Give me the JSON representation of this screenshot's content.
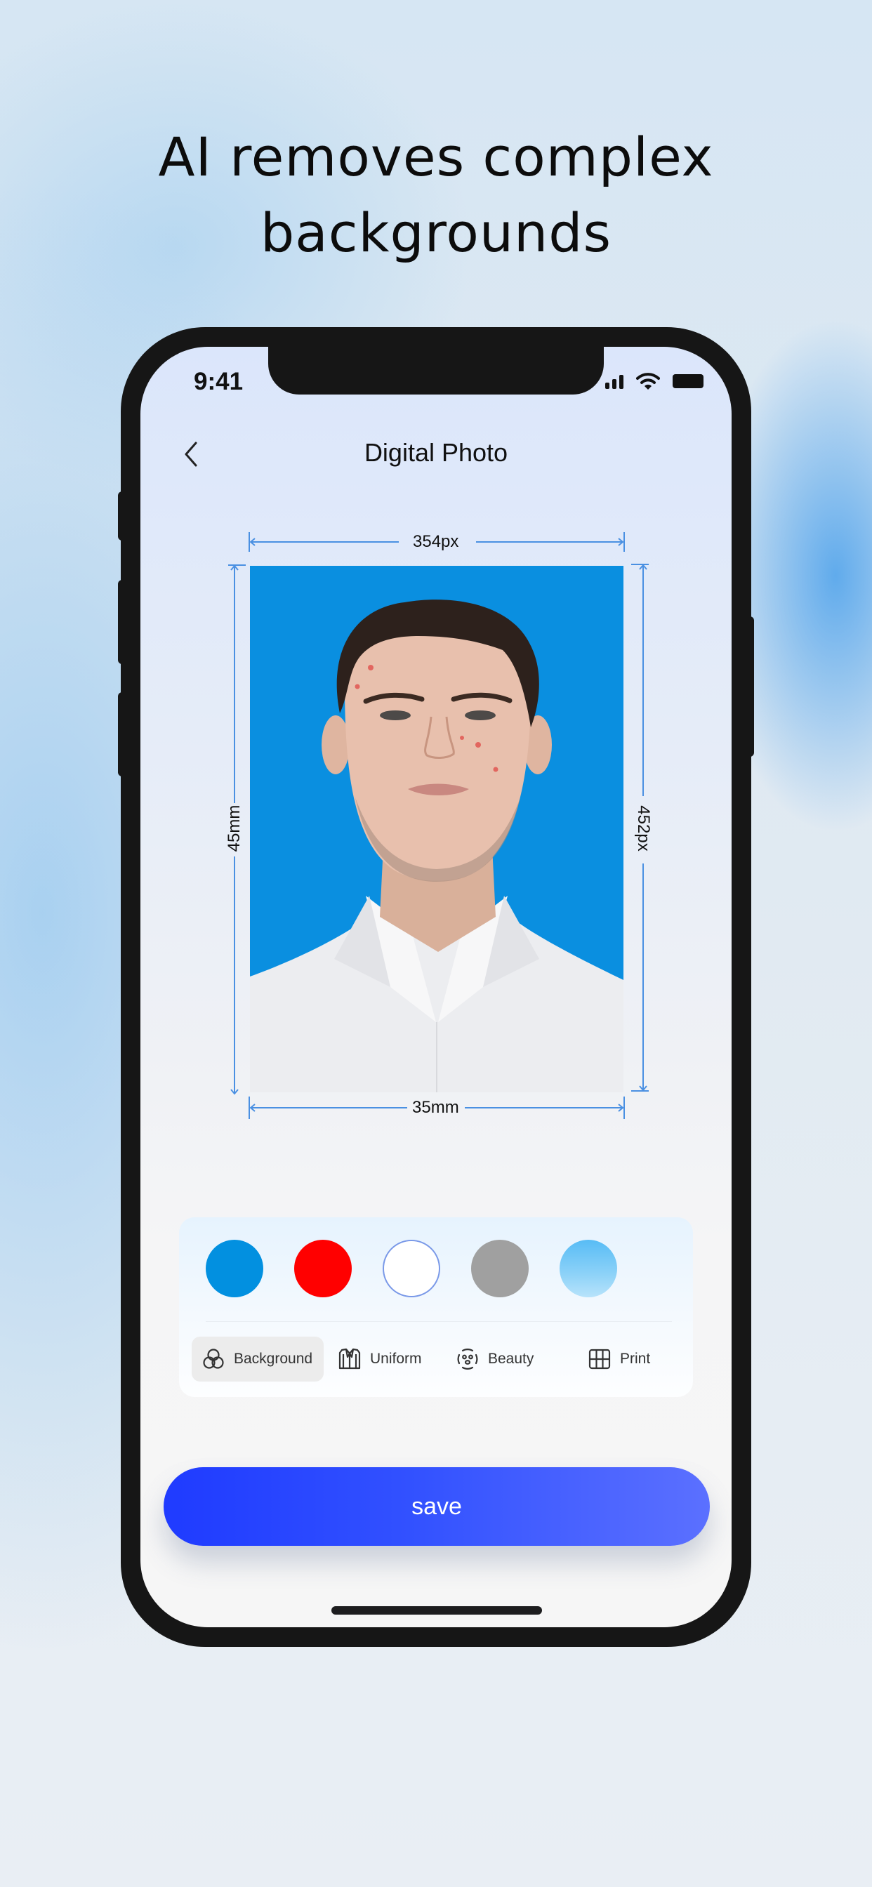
{
  "headline": {
    "line1": "AI removes complex",
    "line2": "backgrounds"
  },
  "status_bar": {
    "time": "9:41",
    "icons": [
      "signal-icon",
      "wifi-icon",
      "battery-icon"
    ]
  },
  "nav": {
    "back_icon": "chevron-left-icon",
    "title": "Digital Photo"
  },
  "photo": {
    "width_px_label": "354px",
    "height_px_label": "452px",
    "width_mm_label": "35mm",
    "height_mm_label": "45mm",
    "background_color": "#0a8fe0"
  },
  "background_colors": [
    {
      "name": "blue",
      "color": "#0290e0",
      "selected": false
    },
    {
      "name": "red",
      "color": "#ff0000",
      "selected": false
    },
    {
      "name": "white",
      "color": "#ffffff",
      "selected": true
    },
    {
      "name": "gray",
      "color": "#a0a0a0",
      "selected": false
    },
    {
      "name": "light-blue-gradient",
      "color": "#5bbdf5",
      "selected": false
    }
  ],
  "tabs": [
    {
      "label": "Background",
      "icon": "layers-circles-icon",
      "active": true
    },
    {
      "label": "Uniform",
      "icon": "suit-icon",
      "active": false
    },
    {
      "label": "Beauty",
      "icon": "face-mask-icon",
      "active": false
    },
    {
      "label": "Print",
      "icon": "grid-icon",
      "active": false
    }
  ],
  "save_button": {
    "label": "save"
  },
  "colors": {
    "accent": "#2a47ff",
    "dimension_lines": "#4a90e2"
  }
}
